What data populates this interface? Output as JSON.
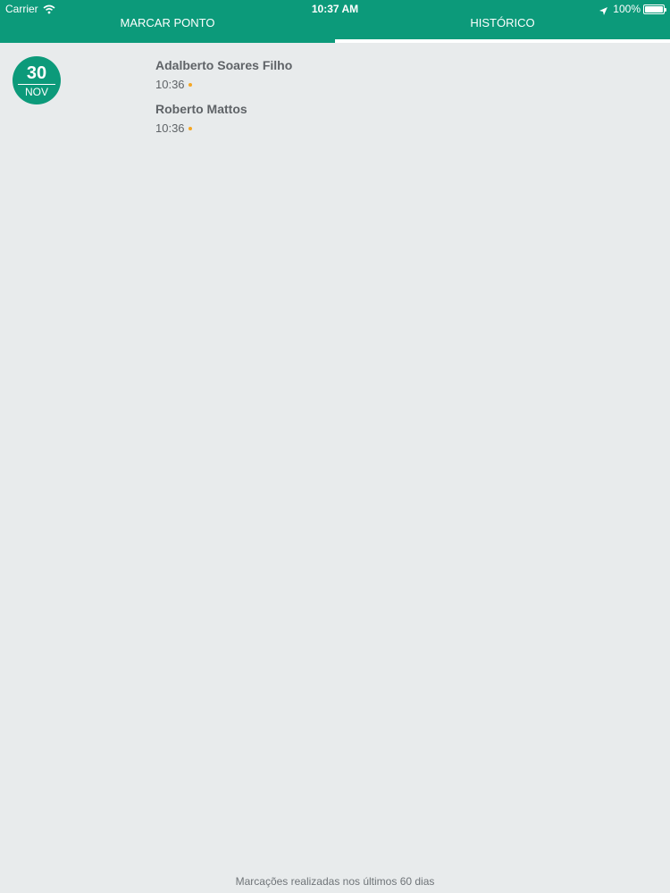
{
  "status_bar": {
    "carrier": "Carrier",
    "time": "10:37 AM",
    "battery": "100%",
    "icons": [
      "wifi-icon",
      "location-icon",
      "battery-icon"
    ]
  },
  "tabs": [
    {
      "label": "MARCAR PONTO",
      "active": false
    },
    {
      "label": "HISTÓRICO",
      "active": true
    }
  ],
  "history": {
    "date": {
      "day": "30",
      "month": "NOV"
    },
    "entries": [
      {
        "name": "Adalberto Soares Filho",
        "time": "10:36"
      },
      {
        "name": "Roberto Mattos",
        "time": "10:36"
      }
    ]
  },
  "footer": {
    "text": "Marcações realizadas nos últimos 60 dias"
  },
  "colors": {
    "primary": "#0c9a7a",
    "background": "#e8ebec",
    "text": "#5f6367",
    "dot": "#f5a623",
    "white": "#ffffff"
  }
}
